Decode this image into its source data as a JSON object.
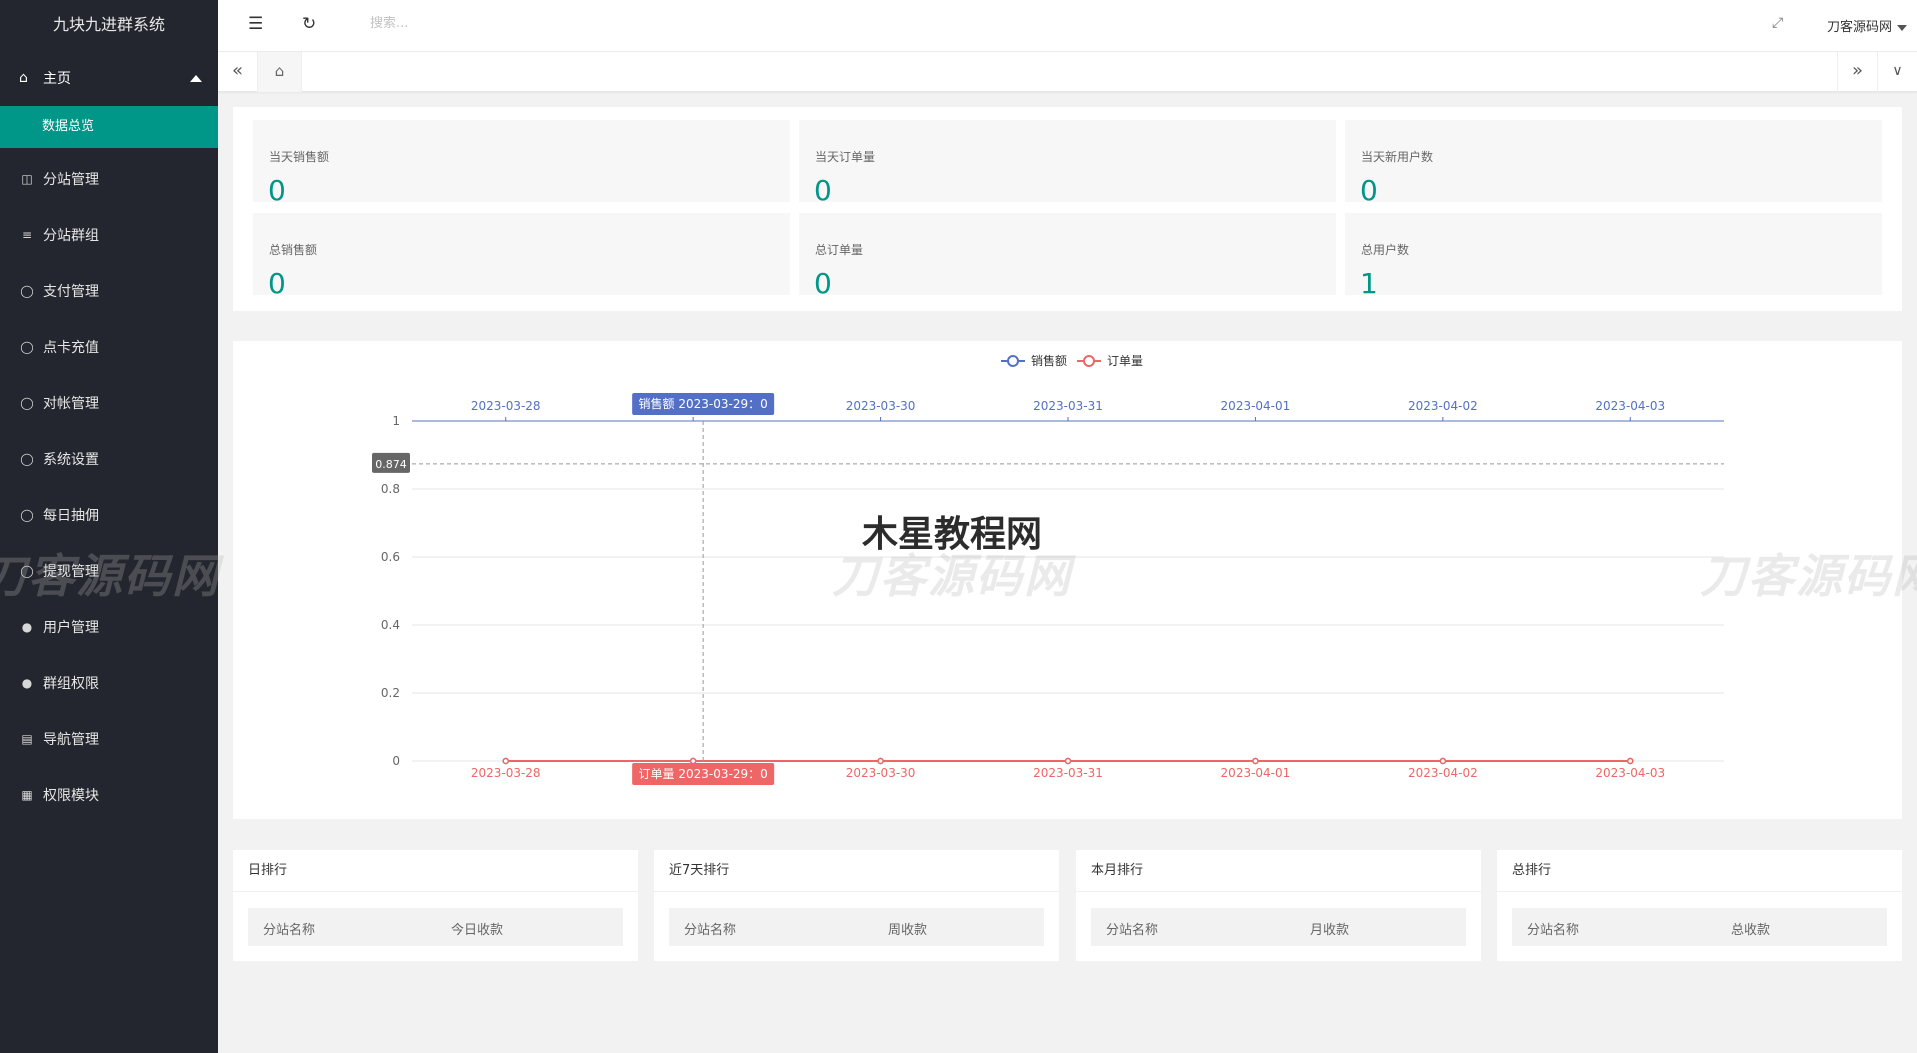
{
  "app": {
    "title": "九块九进群系统"
  },
  "sidebar": {
    "home": {
      "label": "主页",
      "icon": "home-icon"
    },
    "active_sub": "数据总览",
    "items": [
      {
        "label": "分站管理",
        "icon": "columns-icon"
      },
      {
        "label": "分站群组",
        "icon": "sliders-icon"
      },
      {
        "label": "支付管理",
        "icon": "shield-icon"
      },
      {
        "label": "点卡充值",
        "icon": "shield-icon"
      },
      {
        "label": "对帐管理",
        "icon": "shield-icon"
      },
      {
        "label": "系统设置",
        "icon": "shield-icon"
      },
      {
        "label": "每日抽佣",
        "icon": "shield-icon"
      },
      {
        "label": "提现管理",
        "icon": "shield-icon"
      },
      {
        "label": "用户管理",
        "icon": "user-icon"
      },
      {
        "label": "群组权限",
        "icon": "users-icon"
      },
      {
        "label": "导航管理",
        "icon": "nav-icon"
      },
      {
        "label": "权限模块",
        "icon": "grid-icon"
      }
    ]
  },
  "header": {
    "search_placeholder": "搜索...",
    "user_name": "刀客源码网"
  },
  "stats": [
    {
      "label": "当天销售额",
      "value": "0"
    },
    {
      "label": "当天订单量",
      "value": "0"
    },
    {
      "label": "当天新用户数",
      "value": "0"
    },
    {
      "label": "总销售额",
      "value": "0"
    },
    {
      "label": "总订单量",
      "value": "0"
    },
    {
      "label": "总用户数",
      "value": "1"
    }
  ],
  "chart_data": {
    "type": "line",
    "x": [
      "2023-03-28",
      "2023-03-29",
      "2023-03-30",
      "2023-03-31",
      "2023-04-01",
      "2023-04-02",
      "2023-04-03"
    ],
    "series": [
      {
        "name": "销售额",
        "values": [
          0,
          0,
          0,
          0,
          0,
          0,
          0
        ],
        "color": "#5470c6"
      },
      {
        "name": "订单量",
        "values": [
          0,
          0,
          0,
          0,
          0,
          0,
          0
        ],
        "color": "#ee6666"
      }
    ],
    "y_ticks": [
      "0",
      "0.2",
      "0.4",
      "0.6",
      "0.8",
      "1"
    ],
    "ylim": [
      0,
      1
    ],
    "legend_position": "top-center",
    "pointer": {
      "y_readout": "0.874",
      "top_tip": "销售额  2023-03-29：0",
      "bottom_tip": "订单量  2023-03-29：0",
      "x_index": 1
    },
    "grid": true
  },
  "ranks": [
    {
      "title": "日排行",
      "col1": "分站名称",
      "col2": "今日收款"
    },
    {
      "title": "近7天排行",
      "col1": "分站名称",
      "col2": "周收款"
    },
    {
      "title": "本月排行",
      "col1": "分站名称",
      "col2": "月收款"
    },
    {
      "title": "总排行",
      "col1": "分站名称",
      "col2": "总收款"
    }
  ],
  "watermarks": {
    "main": "木星教程网",
    "faded": "刀客源码网"
  }
}
